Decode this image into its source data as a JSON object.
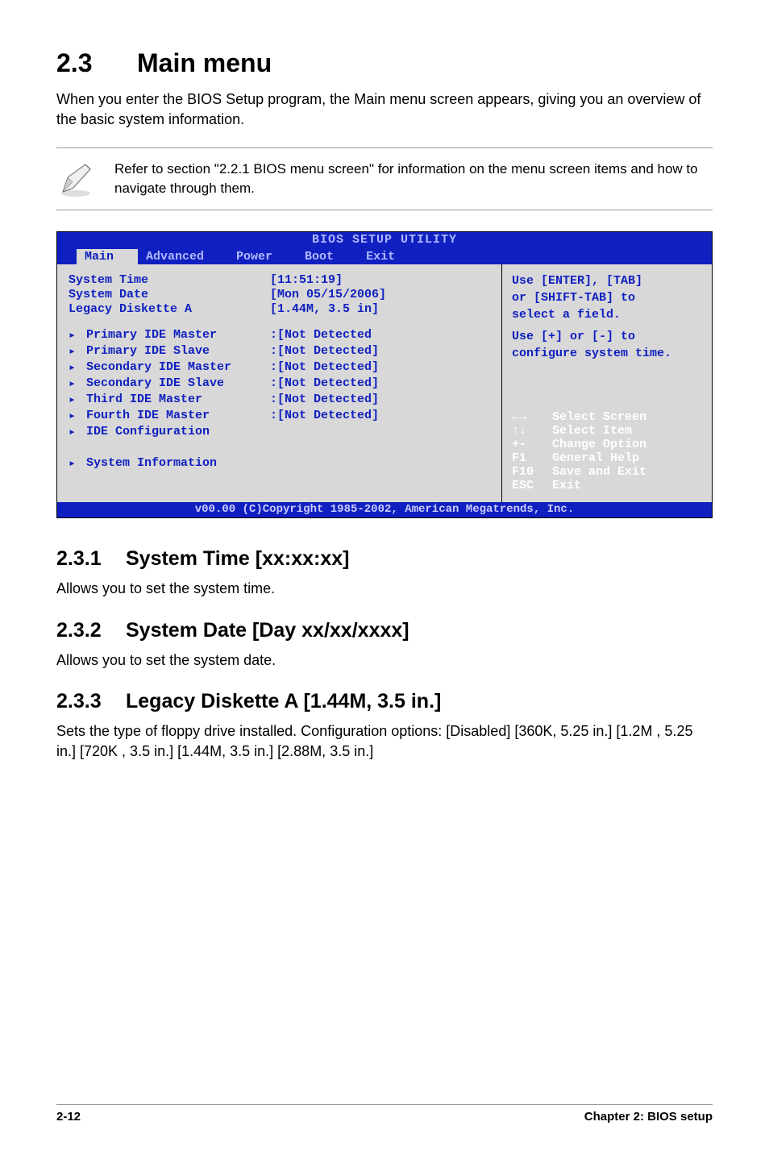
{
  "section": {
    "num": "2.3",
    "title": "Main menu"
  },
  "intro": "When you enter the BIOS Setup program, the Main menu screen appears, giving you an overview of the basic system information.",
  "note": "Refer to section \"2.2.1  BIOS menu screen\" for information on the menu screen items and how to navigate through them.",
  "bios": {
    "title": "BIOS SETUP UTILITY",
    "tabs": [
      "Main",
      "Advanced",
      "Power",
      "Boot",
      "Exit"
    ],
    "rows_top": [
      {
        "label": "System Time",
        "val": "[11:51:19]"
      },
      {
        "label": "System Date",
        "val": "[Mon 05/15/2006]"
      },
      {
        "label": "Legacy Diskette A",
        "val": "[1.44M, 3.5 in]"
      }
    ],
    "rows_arrow": [
      {
        "label": "Primary IDE Master",
        "val": ":[Not Detected"
      },
      {
        "label": "Primary IDE Slave",
        "val": ":[Not Detected]"
      },
      {
        "label": "Secondary IDE Master",
        "val": ":[Not Detected]"
      },
      {
        "label": "Secondary IDE Slave",
        "val": ":[Not Detected]"
      },
      {
        "label": "Third IDE Master",
        "val": ":[Not Detected]"
      },
      {
        "label": "Fourth IDE Master",
        "val": ":[Not Detected]"
      },
      {
        "label": "IDE Configuration",
        "val": ""
      }
    ],
    "rows_bottom": [
      {
        "label": "System Information",
        "val": ""
      }
    ],
    "help_top": [
      "Use [ENTER], [TAB]",
      "or [SHIFT-TAB] to",
      "select a field.",
      "Use [+] or [-] to",
      "configure system time."
    ],
    "help_bottom": [
      {
        "key": "←→",
        "act": "Select Screen"
      },
      {
        "key": "↑↓",
        "act": "Select Item"
      },
      {
        "key": "+-",
        "act": "Change Option"
      },
      {
        "key": "F1",
        "act": "General Help"
      },
      {
        "key": "F10",
        "act": "Save and Exit"
      },
      {
        "key": "ESC",
        "act": "Exit"
      }
    ],
    "footer": "v00.00 (C)Copyright 1985-2002, American Megatrends, Inc."
  },
  "subsections": [
    {
      "num": "2.3.1",
      "title": "System Time [xx:xx:xx]",
      "text": "Allows you to set the system time."
    },
    {
      "num": "2.3.2",
      "title": "System Date [Day xx/xx/xxxx]",
      "text": "Allows you to set the system date."
    },
    {
      "num": "2.3.3",
      "title": "Legacy Diskette A [1.44M, 3.5 in.]",
      "text": "Sets the type of floppy drive installed. Configuration options: [Disabled] [360K, 5.25 in.] [1.2M , 5.25 in.] [720K , 3.5 in.] [1.44M, 3.5 in.] [2.88M, 3.5 in.]"
    }
  ],
  "footer": {
    "left": "2-12",
    "right": "Chapter 2: BIOS setup"
  }
}
